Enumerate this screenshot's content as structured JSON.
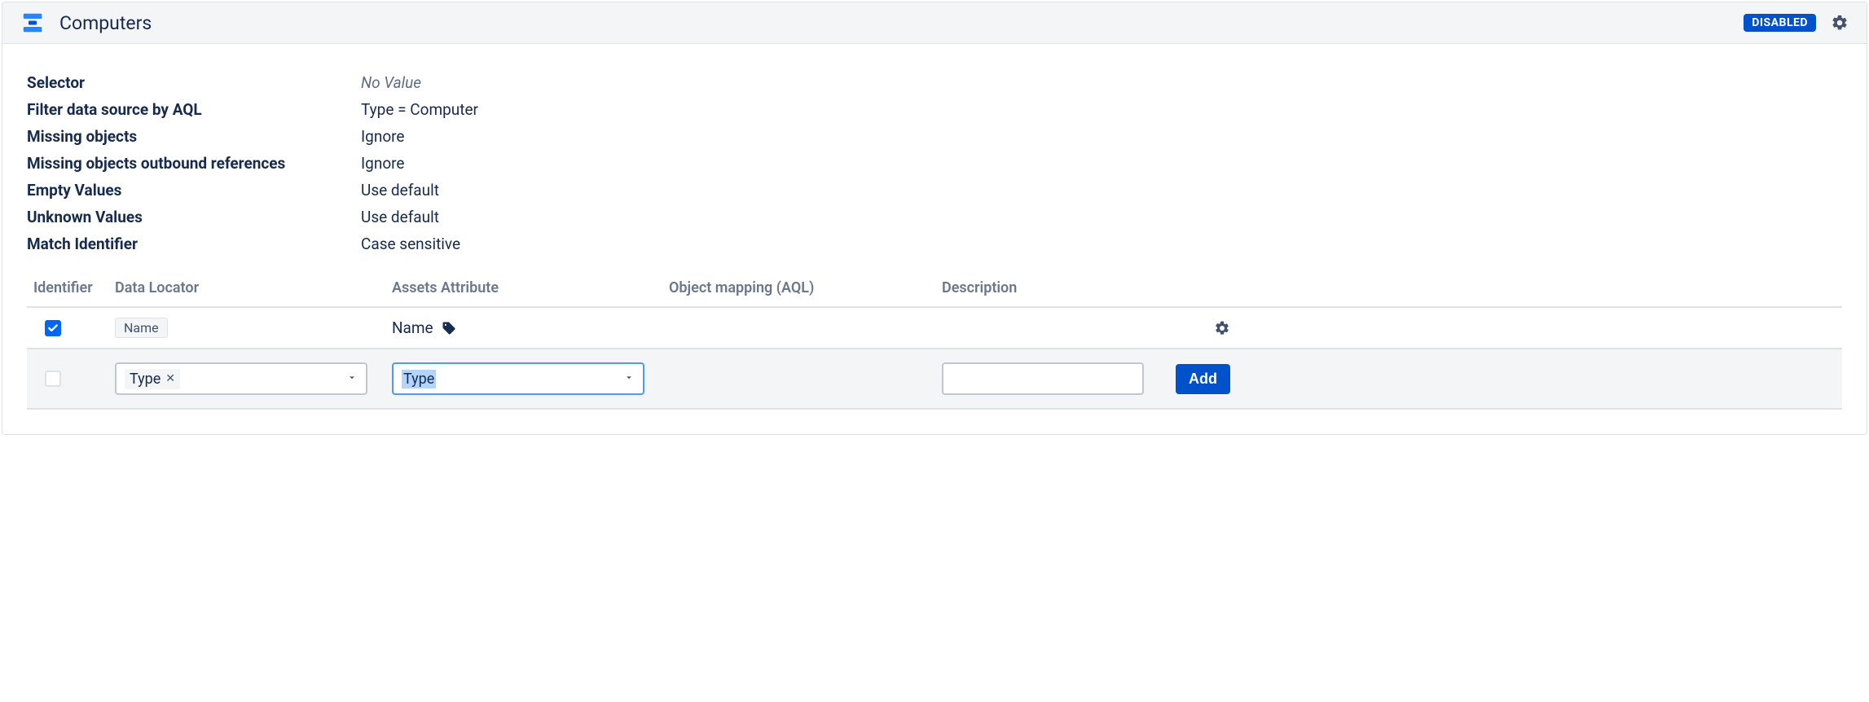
{
  "header": {
    "title": "Computers",
    "status_badge": "DISABLED"
  },
  "properties": [
    {
      "label": "Selector",
      "value": "No Value",
      "italic": true
    },
    {
      "label": "Filter data source by AQL",
      "value": "Type = Computer"
    },
    {
      "label": "Missing objects",
      "value": "Ignore"
    },
    {
      "label": "Missing objects outbound references",
      "value": "Ignore"
    },
    {
      "label": "Empty Values",
      "value": "Use default"
    },
    {
      "label": "Unknown Values",
      "value": "Use default"
    },
    {
      "label": "Match Identifier",
      "value": "Case sensitive"
    }
  ],
  "table": {
    "columns": {
      "identifier": "Identifier",
      "data_locator": "Data Locator",
      "assets_attribute": "Assets Attribute",
      "object_mapping": "Object mapping (AQL)",
      "description": "Description"
    },
    "rows": [
      {
        "identifier_checked": true,
        "data_locator_chip": "Name",
        "assets_attribute": "Name",
        "object_mapping": "",
        "description": ""
      }
    ],
    "edit_row": {
      "identifier_checked": false,
      "data_locator_token": "Type",
      "assets_attribute_value": "Type",
      "description_value": "",
      "add_button_label": "Add"
    }
  }
}
